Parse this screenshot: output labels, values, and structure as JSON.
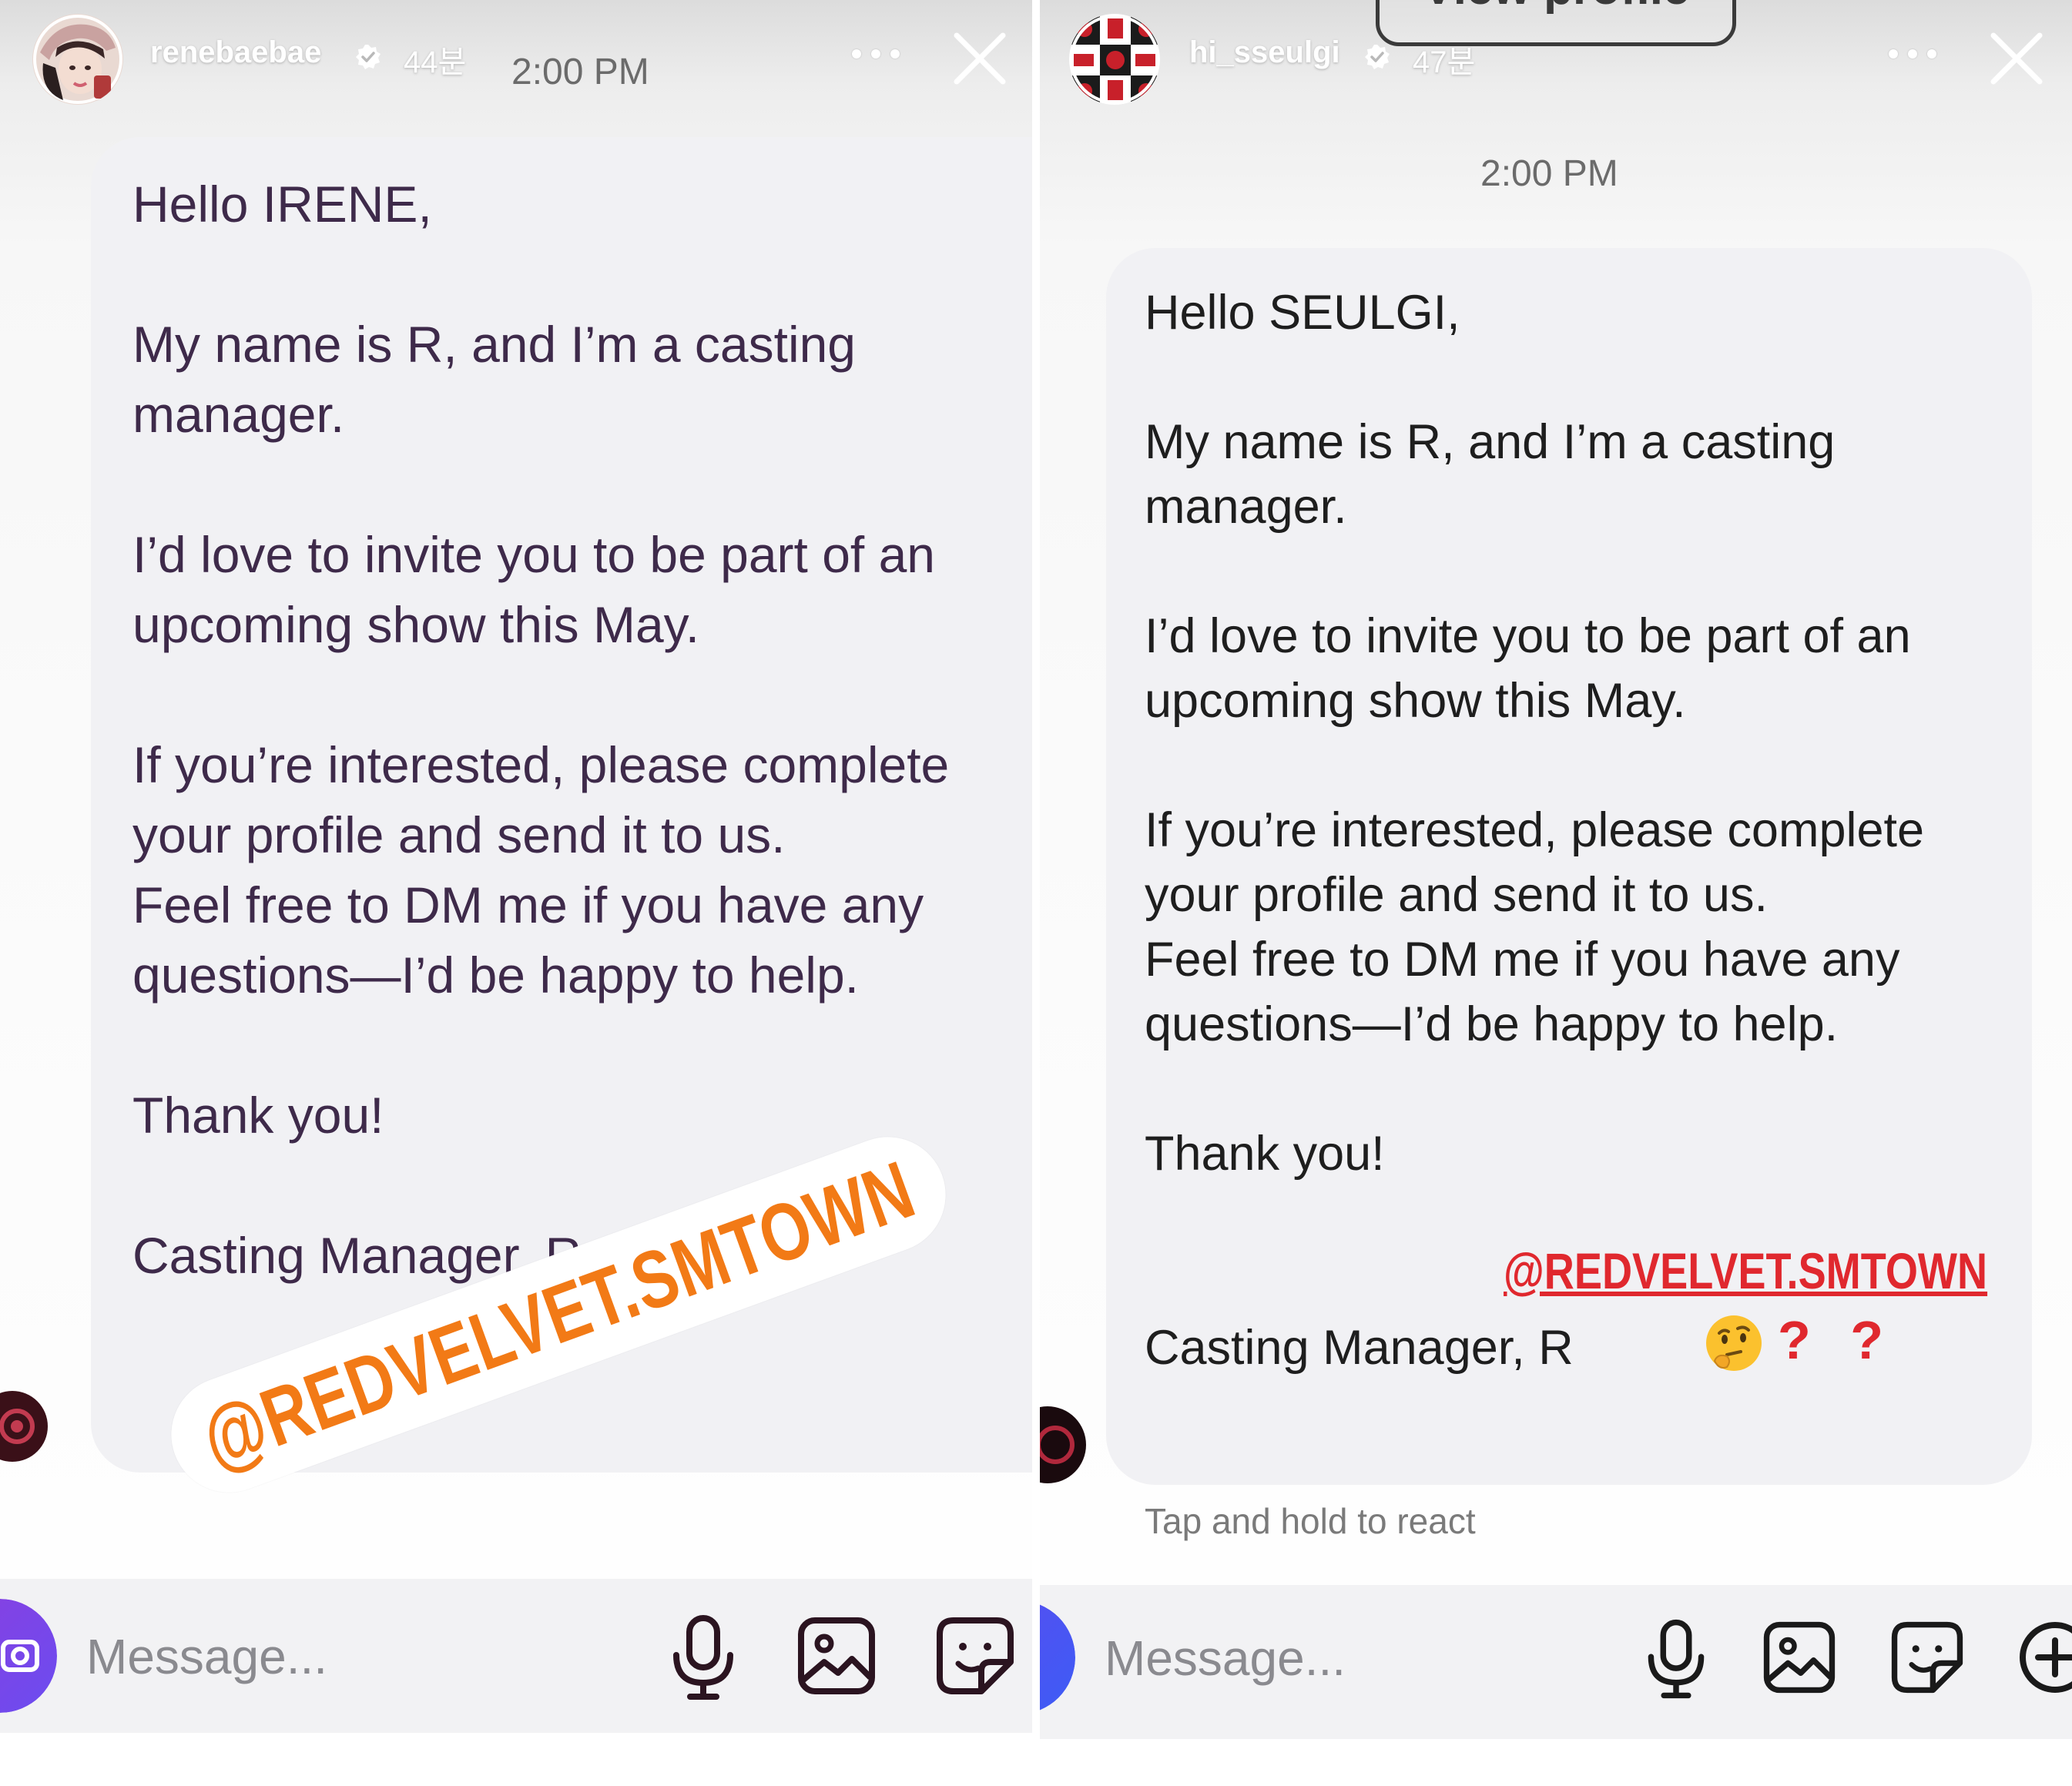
{
  "left_story": {
    "username": "renebaebae",
    "age": "44분",
    "timestamp": "2:00 PM",
    "message": "Hello IRENE,\n\nMy name is R, and I’m a casting manager.\n\nI’d love to invite you to be part of an upcoming show this May.\n\nIf you’re interested, please complete your profile and send it to us.\nFeel free to DM me if you have any questions—I’d be happy to help.\n\nThank you!\n\nCasting Manager, R",
    "sticker": "@REDVELVET.SMTOWN",
    "input_placeholder": "Message..."
  },
  "right_story": {
    "username": "hi_sseulgi",
    "age": "47분",
    "timestamp": "2:00 PM",
    "view_profile_label": "View profile",
    "message": "Hello SEULGI,\n\nMy name is R, and I’m a casting manager.\n\nI’d love to invite you to be part of an upcoming show this May.\n\nIf you’re interested, please complete your profile and send it to us.\nFeel free to DM me if you have any questions—I’d be happy to help.\n\nThank you!\n\n\nCasting Manager, R",
    "mention": "@REDVELVET.SMTOWN",
    "emoji_text": "? ?",
    "react_hint": "Tap and hold to react",
    "input_placeholder": "Message..."
  },
  "icons": [
    "verified-icon",
    "more-icon",
    "close-icon",
    "camera-icon",
    "microphone-icon",
    "gallery-icon",
    "sticker-icon",
    "add-icon",
    "thinking-face-icon"
  ],
  "colors": {
    "left_text": "#3e2a4a",
    "right_text": "#1e1e1e",
    "bubble": "#f1f1f4",
    "sticker_text": "#f27a16",
    "mention_red": "#e0282e",
    "camera_gradient_start": "#7b3fe4",
    "camera_gradient_end": "#4f5bf0"
  }
}
